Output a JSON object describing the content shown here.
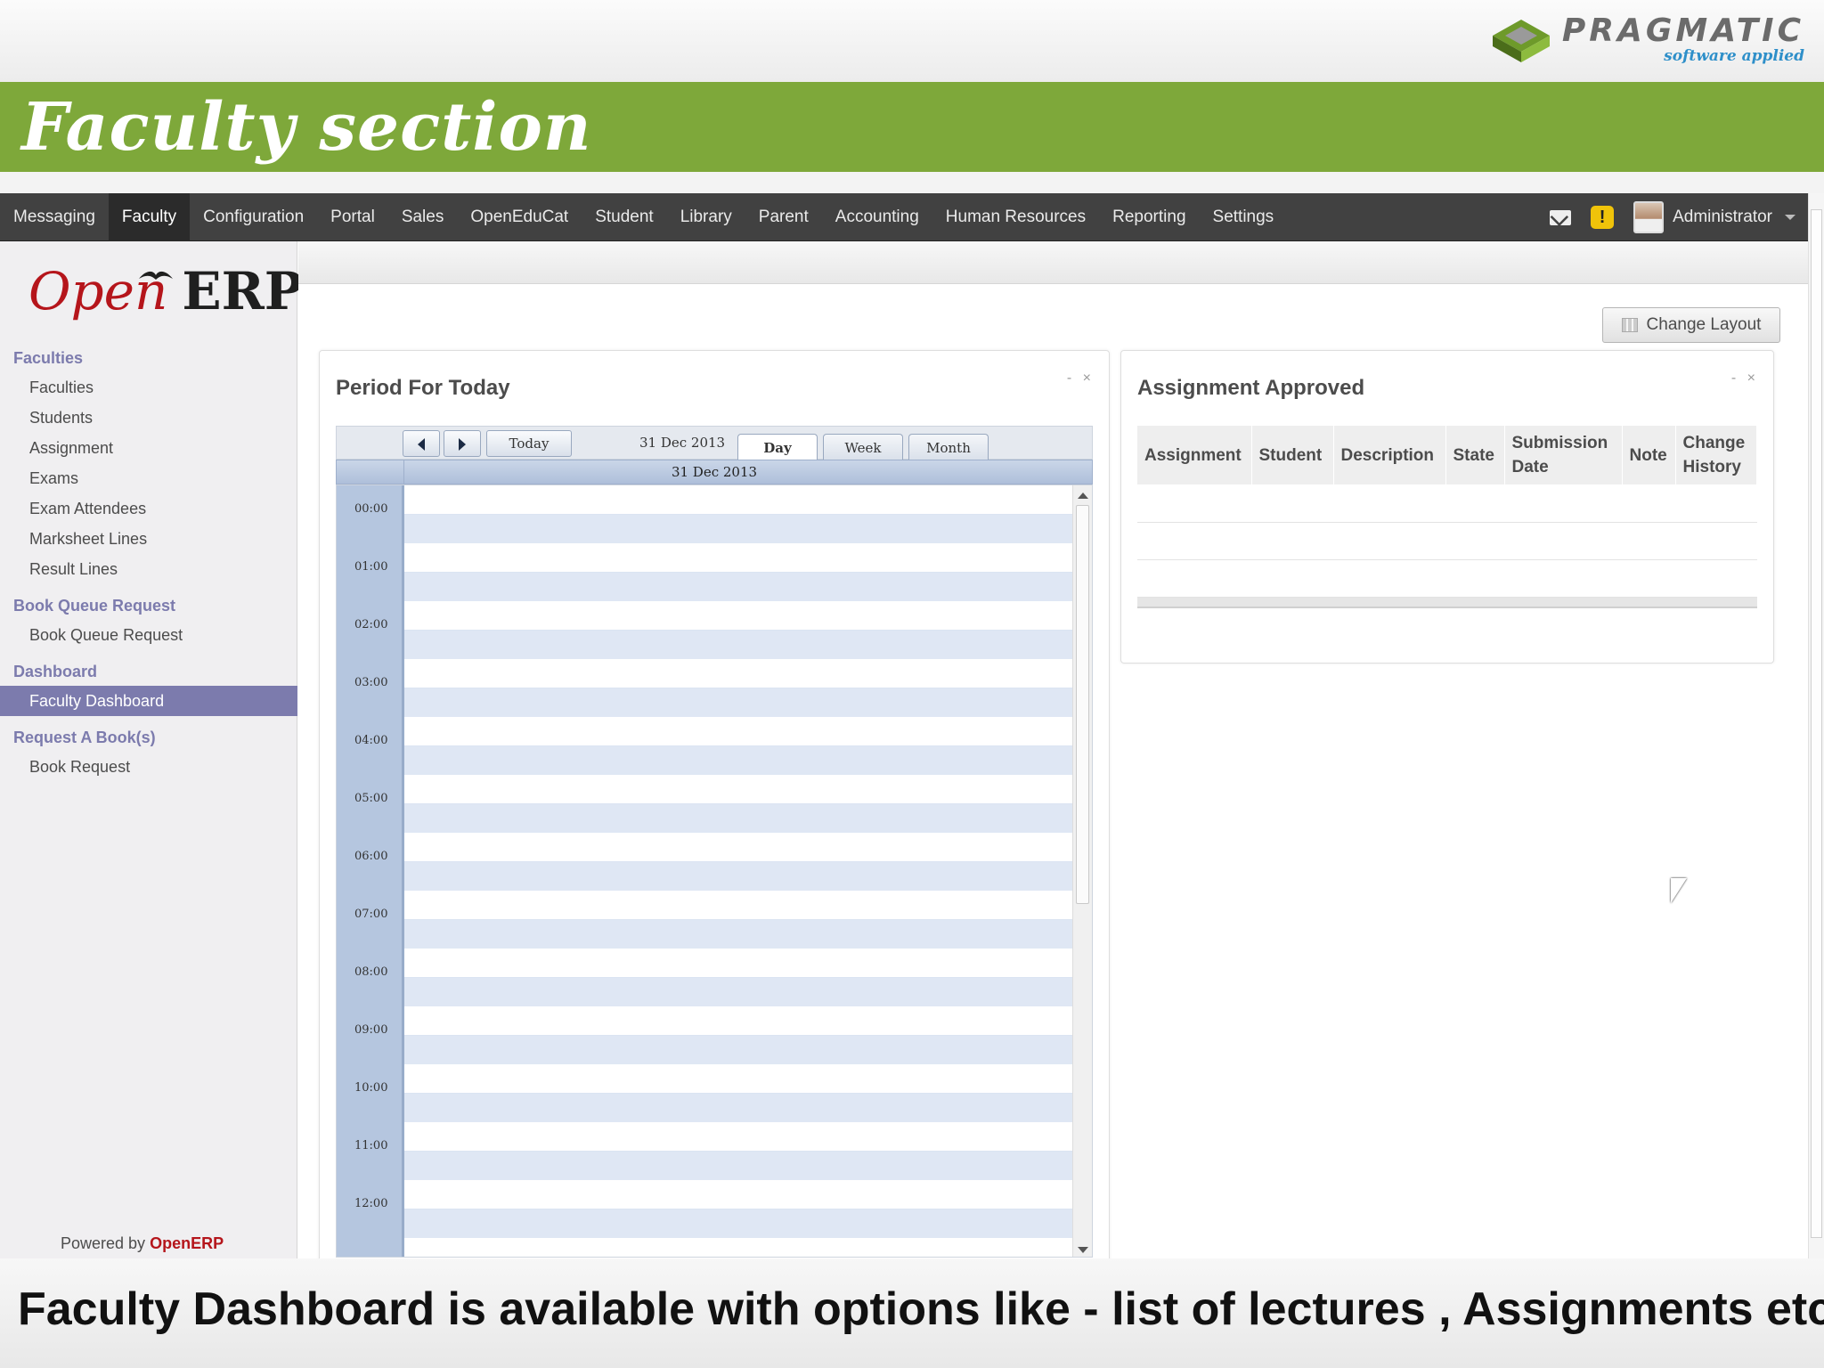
{
  "slide": {
    "title": "Faculty section",
    "caption": "Faculty Dashboard is available with options like  - list of lectures , Assignments etc",
    "brand_name": "PRAGMATIC",
    "brand_tagline": "software applied",
    "colors": {
      "band": "#7ea83a",
      "brand_tag": "#2e8fc9"
    }
  },
  "topnav": {
    "items": [
      "Messaging",
      "Faculty",
      "Configuration",
      "Portal",
      "Sales",
      "OpenEduCat",
      "Student",
      "Library",
      "Parent",
      "Accounting",
      "Human Resources",
      "Reporting",
      "Settings"
    ],
    "active": "Faculty",
    "icons": [
      "envelope-icon",
      "warning-icon"
    ],
    "user": "Administrator"
  },
  "sidebar": {
    "logo_open": "Open",
    "logo_erp": "ERP",
    "sections": [
      {
        "heading": "Faculties",
        "items": [
          "Faculties",
          "Students",
          "Assignment",
          "Exams",
          "Exam Attendees",
          "Marksheet Lines",
          "Result Lines"
        ]
      },
      {
        "heading": "Book Queue Request",
        "items": [
          "Book Queue Request"
        ]
      },
      {
        "heading": "Dashboard",
        "items": [
          "Faculty Dashboard"
        ]
      },
      {
        "heading": "Request A Book(s)",
        "items": [
          "Book Request"
        ]
      }
    ],
    "active_item": "Faculty Dashboard",
    "powered_prefix": "Powered by",
    "powered_brand": "OpenERP",
    "colors": {
      "heading": "#7c7bad",
      "active_bg": "#7c7bad",
      "brand_red": "#b5151b"
    }
  },
  "content": {
    "change_layout_label": "Change Layout",
    "period_panel": {
      "title": "Period For Today",
      "controls": "- ×",
      "today_label": "Today",
      "current_date": "31 Dec 2013",
      "views": [
        "Day",
        "Week",
        "Month"
      ],
      "active_view": "Day",
      "day_header": "31 Dec 2013",
      "hours": [
        "00:00",
        "01:00",
        "02:00",
        "03:00",
        "04:00",
        "05:00",
        "06:00",
        "07:00",
        "08:00",
        "09:00",
        "10:00",
        "11:00",
        "12:00"
      ]
    },
    "assignment_panel": {
      "title": "Assignment Approved",
      "controls": "- ×",
      "columns": [
        "Assignment",
        "Student",
        "Description",
        "State",
        "Submission Date",
        "Note",
        "Change History"
      ],
      "rows": []
    }
  }
}
